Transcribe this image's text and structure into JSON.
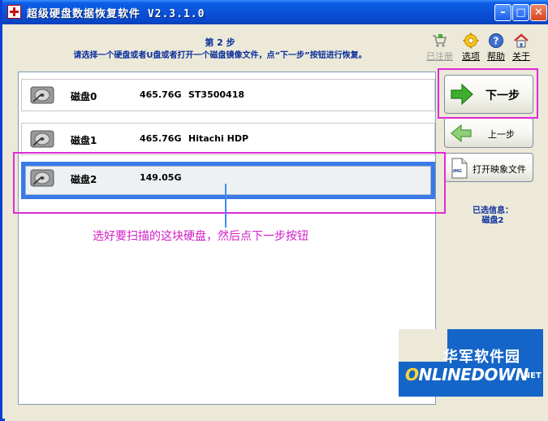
{
  "window": {
    "title": "超级硬盘数据恢复软件 V2.3.1.0",
    "controls": {
      "minimize": "–",
      "maximize": "□",
      "close": "✕"
    }
  },
  "header": {
    "step_title": "第 2 步",
    "step_desc": "请选择一个硬盘或者U盘或者打开一个磁盘镜像文件，点“下一步”按钮进行恢复。"
  },
  "toolbar": {
    "items": [
      {
        "label": "已注册",
        "icon": "cart-icon",
        "enabled": false
      },
      {
        "label": "选项",
        "icon": "gear-icon",
        "enabled": true
      },
      {
        "label": "帮助",
        "icon": "help-icon",
        "enabled": true
      },
      {
        "label": "关于",
        "icon": "home-icon",
        "enabled": true
      }
    ]
  },
  "disks": [
    {
      "name": "磁盘0",
      "size": "465.76G",
      "model": "ST3500418",
      "selected": false
    },
    {
      "name": "磁盘1",
      "size": "465.76G",
      "model": "Hitachi HDP",
      "selected": false
    },
    {
      "name": "磁盘2",
      "size": "149.05G",
      "model": "",
      "selected": true
    }
  ],
  "buttons": {
    "next": "下一步",
    "prev": "上一步",
    "open_image": "打开映象文件",
    "open_image_icon_text": "IMG"
  },
  "selection_info": {
    "label": "已选信息：",
    "value": "磁盘2"
  },
  "annotation": {
    "text": "选好要扫描的这块硬盘，然后点下一步按钮",
    "color": "#d31ec8"
  },
  "watermark": {
    "cn": "华军软件园",
    "en_o": "O",
    "en_rest": "NLINEDOWN",
    "net": ".NET"
  },
  "colors": {
    "title_bar": "#0a52d8",
    "selection": "#3a7ae8",
    "highlight": "#e02ad6",
    "heading_text": "#0b2f9c",
    "arrow_green": "#3fae2f"
  }
}
